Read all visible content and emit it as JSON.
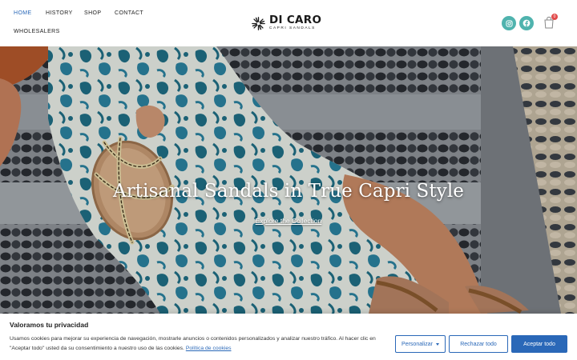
{
  "nav": {
    "items": [
      {
        "label": "HOME"
      },
      {
        "label": "HISTORY"
      },
      {
        "label": "SHOP"
      },
      {
        "label": "CONTACT"
      },
      {
        "label": "WHOLESALERS"
      }
    ]
  },
  "logo": {
    "title": "DI CARO",
    "subtitle": "CAPRI SANDALS"
  },
  "header_icons": {
    "instagram": "instagram-icon",
    "facebook": "facebook-icon",
    "cart": "cart-icon",
    "cart_count": "0"
  },
  "hero": {
    "title": "Artisanal Sandals in True Capri Style",
    "link": "Explore the Collection"
  },
  "cookie": {
    "title": "Valoramos tu privacidad",
    "text": "Usamos cookies para mejorar su experiencia de navegación, mostrarle anuncios o contenidos personalizados y analizar nuestro tráfico. Al hacer clic en \"Aceptar todo\" usted da su consentimiento a nuestro uso de las cookies.",
    "policy_link": "Política de cookies",
    "customize": "Personalizar",
    "reject": "Rechazar todo",
    "accept": "Aceptar todo"
  },
  "colors": {
    "accent": "#2a68b8",
    "social": "#4fb3ae",
    "badge": "#e14a4a"
  }
}
